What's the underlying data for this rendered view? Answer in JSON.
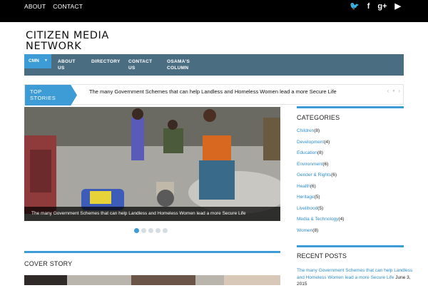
{
  "topnav": {
    "about": "ABOUT",
    "contact": "CONTACT"
  },
  "social": {
    "twitter": "twitter-icon",
    "facebook": "facebook-icon",
    "googleplus": "google-plus-icon",
    "youtube": "youtube-icon",
    "twitter_glyph": "🐦",
    "facebook_glyph": "f",
    "googleplus_glyph": "g+",
    "youtube_glyph": "▶"
  },
  "brand": {
    "line1": "CITIZEN MEDIA",
    "line2": "NETWORK"
  },
  "mainnav": {
    "cmn": "CMN",
    "about_line1": "ABOUT",
    "about_line2": "US",
    "directory": "DIRECTORY",
    "contact_line1": "CONTACT",
    "contact_line2": "US",
    "osama_line1": "OSAMA'S",
    "osama_line2": "COLUMN"
  },
  "ticker": {
    "label_line1": "TOP",
    "label_line2": "STORIES",
    "text": "The many Government Schemes that can help Landless and Homeless Women lead a more Secure Life",
    "prev": "‹",
    "pause": "⏸",
    "next": "›"
  },
  "slider": {
    "caption": "The many Government Schemes that can help Landless and Homeless Women lead a more Secure Life",
    "dots": 5,
    "active_dot": 1
  },
  "sections": {
    "cover_story": "COVER STORY"
  },
  "sidebar": {
    "categories_title": "CATEGORIES",
    "categories": [
      {
        "name": "Children",
        "count": "(8)"
      },
      {
        "name": "Development",
        "count": "(4)"
      },
      {
        "name": "Education",
        "count": "(8)"
      },
      {
        "name": "Environment",
        "count": "(6)"
      },
      {
        "name": "Gender & Rights",
        "count": "(6)"
      },
      {
        "name": "Health",
        "count": "(6)"
      },
      {
        "name": "Heritage",
        "count": "(5)"
      },
      {
        "name": "Livelihood",
        "count": "(5)"
      },
      {
        "name": "Media & Technology",
        "count": "(4)"
      },
      {
        "name": "Women",
        "count": "(8)"
      }
    ],
    "recent_title": "RECENT POSTS",
    "recent_post": "The many Government Schemes that can help Landless and Homeless Women lead a more Secure Life",
    "recent_date": "June 3, 2015"
  },
  "colors": {
    "accent": "#3d9bd5",
    "nav": "#4a6d82",
    "topbar": "#000000"
  }
}
